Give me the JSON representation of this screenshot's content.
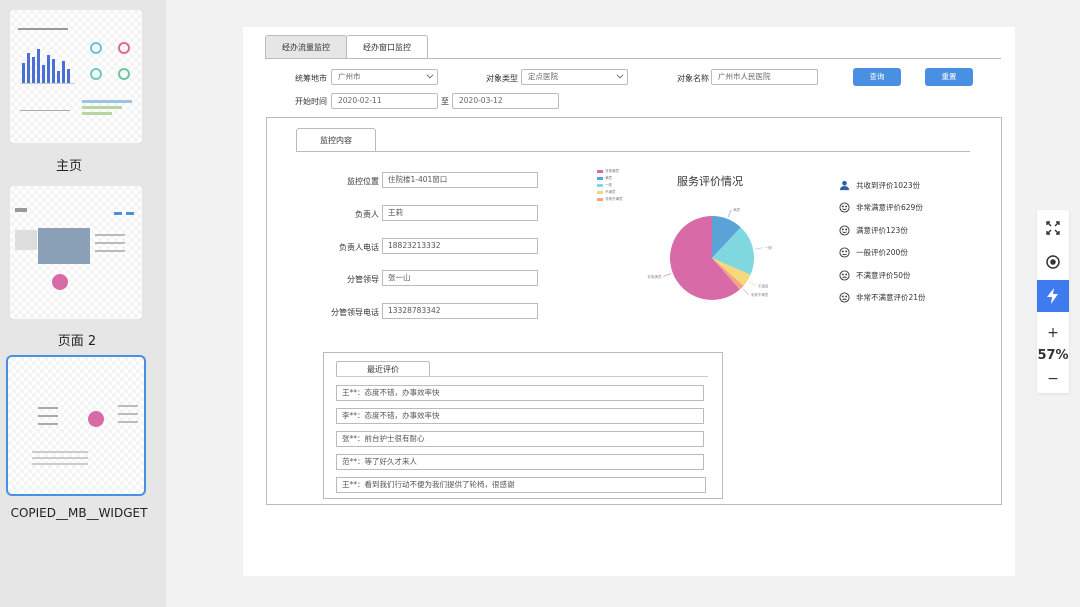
{
  "pages": [
    {
      "label": "主页"
    },
    {
      "label": "页面 2"
    },
    {
      "label": "COPIED__MB__WIDGET"
    }
  ],
  "tabs": [
    {
      "label": "经办流量监控",
      "active": true
    },
    {
      "label": "经办窗口监控",
      "active": false
    }
  ],
  "filters": {
    "city_label": "统筹地市",
    "city_value": "广州市",
    "type_label": "对象类型",
    "type_value": "定点医院",
    "name_label": "对象名称",
    "name_value": "广州市人民医院",
    "time_label": "开始时间",
    "start_date": "2020-02-11",
    "to_label": "至",
    "end_date": "2020-03-12",
    "query_button": "查询",
    "reset_button": "重置"
  },
  "monitor": {
    "tab_label": "监控内容",
    "fields": [
      {
        "label": "监控位置",
        "value": "住院楼1-401窗口"
      },
      {
        "label": "负责人",
        "value": "王莉"
      },
      {
        "label": "负责人电话",
        "value": "18823213332"
      },
      {
        "label": "分管领导",
        "value": "张一山"
      },
      {
        "label": "分管领导电话",
        "value": "13328783342"
      }
    ]
  },
  "chart_data": {
    "type": "pie",
    "title": "服务评价情况",
    "slices": [
      {
        "label": "非常满意",
        "value": 629,
        "color": "#d96aa8"
      },
      {
        "label": "满意",
        "value": 123,
        "color": "#5aa3d6"
      },
      {
        "label": "一般",
        "value": 200,
        "color": "#7fd8df"
      },
      {
        "label": "不满意",
        "value": 50,
        "color": "#f7d97a"
      },
      {
        "label": "非常不满意",
        "value": 21,
        "color": "#f5a385"
      }
    ],
    "legend_position": "top-left"
  },
  "stats": [
    {
      "icon": "person-icon",
      "text": "共收到评价1023份"
    },
    {
      "icon": "smile-icon",
      "text": "非常满意评价629份"
    },
    {
      "icon": "smile-icon",
      "text": "满意评价123份"
    },
    {
      "icon": "neutral-face-icon",
      "text": "一般评价200份"
    },
    {
      "icon": "frown-icon",
      "text": "不满意评价50份"
    },
    {
      "icon": "frown-icon",
      "text": "非常不满意评价21份"
    }
  ],
  "reviews": {
    "tab_label": "最近评价",
    "items": [
      "王**：态度不错，办事效率快",
      "李**：态度不错，办事效率快",
      "张**：前台护士很有耐心",
      "范**：等了好久才来人",
      "王**：看到我们行动不便为我们提供了轮椅，很感谢"
    ]
  },
  "toolbar": {
    "zoom": "57%",
    "zoom_in": "+",
    "zoom_out": "−"
  }
}
